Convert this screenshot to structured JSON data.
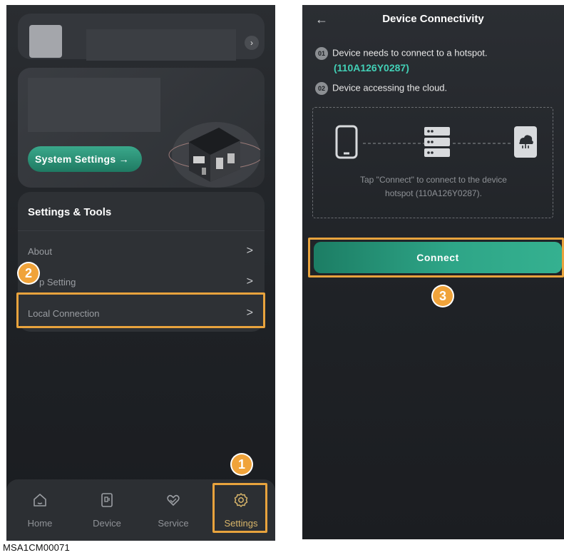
{
  "left": {
    "system_settings_label": "System Settings →",
    "tools_title": "Settings & Tools",
    "menu": [
      {
        "label": "About"
      },
      {
        "label": "p Setting"
      },
      {
        "label": "Local Connection"
      }
    ],
    "chevron": ">",
    "tabs": [
      {
        "label": "Home",
        "icon": "home-icon"
      },
      {
        "label": "Device",
        "icon": "device-icon"
      },
      {
        "label": "Service",
        "icon": "service-icon"
      },
      {
        "label": "Settings",
        "icon": "gear-icon"
      }
    ]
  },
  "right": {
    "title": "Device Connectivity",
    "back_icon": "←",
    "step1_num": "01",
    "step1_text": "Device needs to connect to a hotspot.",
    "hotspot_id": "(110A126Y0287)",
    "step2_num": "02",
    "step2_text": "Device accessing the cloud.",
    "caption_line1": "Tap \"Connect\" to connect to the device",
    "caption_line2": "hotspot (110A126Y0287).",
    "connect_label": "Connect"
  },
  "annotations": {
    "step1": "1",
    "step2": "2",
    "step3": "3"
  },
  "footnote": "MSA1CM00071",
  "colors": {
    "accent_teal": "#42d0b6",
    "annotation_orange": "#e8a33d",
    "active_tab": "#d8b56a"
  }
}
